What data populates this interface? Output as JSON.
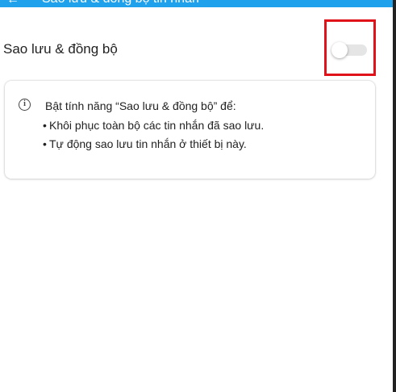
{
  "header": {
    "back_icon": "back-arrow-icon",
    "title": "Sao lưu & đồng bộ tin nhắn",
    "background_color": "#1fa1ec"
  },
  "setting": {
    "label": "Sao lưu & đồng bộ",
    "toggle_state": "off",
    "highlight_color": "#e0131a"
  },
  "info_card": {
    "icon": "info-icon",
    "intro": "Bật tính năng “Sao lưu & đồng bộ” để:",
    "bullets": [
      "Khôi phục toàn bộ các tin nhắn đã sao lưu.",
      "Tự động sao lưu tin nhắn ở thiết bị này."
    ]
  }
}
